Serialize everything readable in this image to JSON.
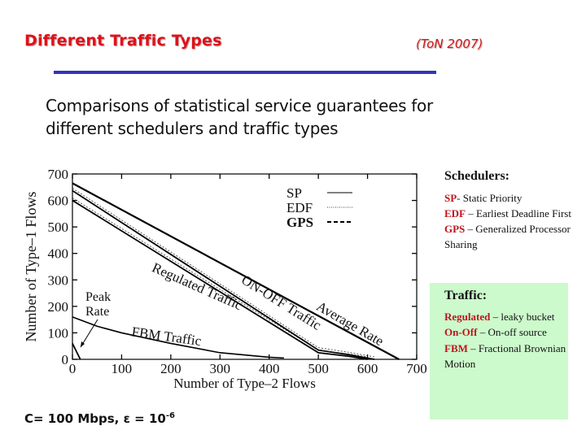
{
  "slide": {
    "title": "Different Traffic Types",
    "reference": "(ToN 2007)",
    "subtitle_line1": "Comparisons of statistical service guarantees for",
    "subtitle_line2": "different schedulers and traffic types",
    "formula_prefix": "C= 100 Mbps,  ε = 10",
    "formula_exp": "-6",
    "colors": {
      "title": "#e0101a",
      "rule": "#3333bb",
      "traffic_box_bg": "#ccfacc",
      "term": "#c0141c"
    }
  },
  "schedulers": {
    "heading": "Schedulers:",
    "items": [
      {
        "term": "SP",
        "desc": "- Static Priority"
      },
      {
        "term": "EDF",
        "desc": " – Earliest Deadline First"
      },
      {
        "term": "GPS",
        "desc": " – Generalized Processor Sharing"
      }
    ]
  },
  "traffic": {
    "heading": "Traffic:",
    "items": [
      {
        "term": "Regulated",
        "desc": " – leaky bucket"
      },
      {
        "term": "On-Off",
        "desc": " – On-off source"
      },
      {
        "term": "FBM",
        "desc": " – Fractional Brownian Motion"
      }
    ]
  },
  "chart_data": {
    "type": "line",
    "title": "",
    "xlabel": "Number of Type–2 Flows",
    "ylabel": "Number of Type–1 Flows",
    "xlim": [
      0,
      700
    ],
    "ylim": [
      0,
      700
    ],
    "xticks": [
      0,
      100,
      200,
      300,
      400,
      500,
      600,
      700
    ],
    "yticks": [
      0,
      100,
      200,
      300,
      400,
      500,
      600,
      700
    ],
    "grid": false,
    "legend": {
      "placement": "top-right",
      "entries": [
        {
          "name": "SP",
          "style": "solid"
        },
        {
          "name": "EDF",
          "style": "dotted"
        },
        {
          "name": "GPS",
          "style": "dashed"
        }
      ]
    },
    "series": [
      {
        "name": "Average Rate",
        "points": [
          [
            0,
            665
          ],
          [
            664,
            0
          ]
        ]
      },
      {
        "name": "ON-OFF Traffic",
        "points": [
          [
            0,
            637
          ],
          [
            500,
            35
          ],
          [
            560,
            18
          ],
          [
            614,
            0
          ]
        ]
      },
      {
        "name": "Regulated Traffic",
        "points": [
          [
            0,
            600
          ],
          [
            500,
            25
          ],
          [
            560,
            12
          ],
          [
            600,
            0
          ]
        ]
      },
      {
        "name": "FBM Traffic",
        "points": [
          [
            0,
            160
          ],
          [
            50,
            125
          ],
          [
            100,
            100
          ],
          [
            200,
            60
          ],
          [
            300,
            25
          ],
          [
            400,
            8
          ],
          [
            430,
            5
          ]
        ]
      },
      {
        "name": "Peak Rate",
        "points": [
          [
            0,
            60
          ],
          [
            16,
            0
          ]
        ]
      }
    ],
    "annotations": [
      {
        "text": "Average Rate",
        "at": [
          560,
          120
        ]
      },
      {
        "text": "ON-OFF Traffic",
        "at": [
          420,
          200
        ]
      },
      {
        "text": "Regulated Traffic",
        "at": [
          250,
          260
        ]
      },
      {
        "text": "FBM Traffic",
        "at": [
          190,
          70
        ]
      },
      {
        "text": "Peak Rate",
        "at": [
          40,
          200
        ]
      }
    ]
  }
}
